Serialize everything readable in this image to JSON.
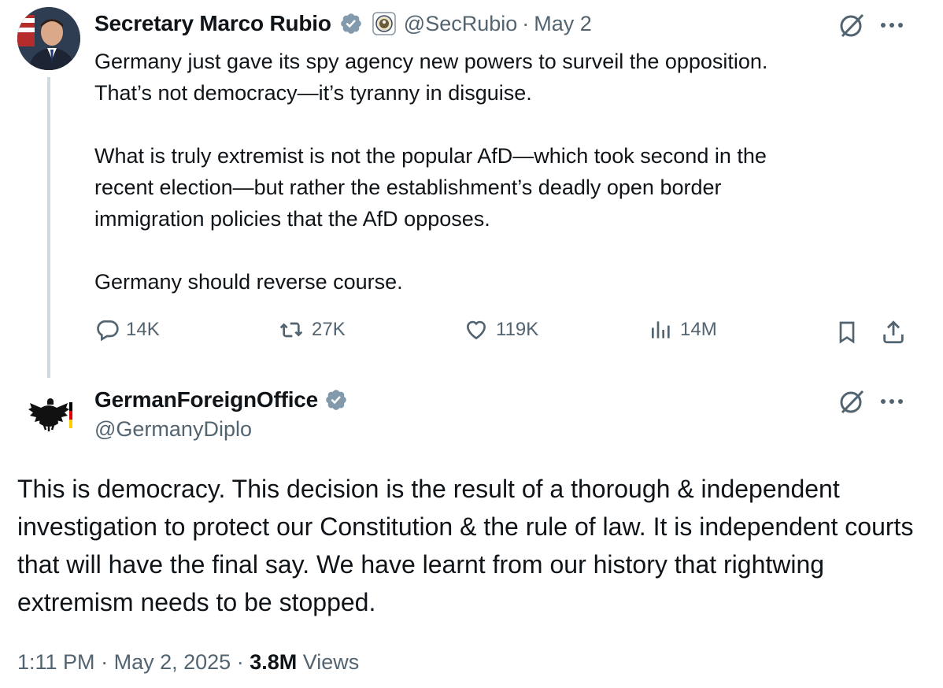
{
  "tweet1": {
    "name": "Secretary Marco Rubio",
    "handle": "@SecRubio",
    "dot": "·",
    "date": "May 2",
    "text": "Germany just gave its spy agency new powers to surveil the opposition.\nThat’s not democracy—it’s tyranny in disguise.\n\nWhat is truly extremist is not the popular AfD—which took second in the\nrecent election—but rather the establishment’s deadly open border\nimmigration policies that the AfD opposes.\n\nGermany should reverse course.",
    "replies": "14K",
    "reposts": "27K",
    "likes": "119K",
    "views": "14M",
    "verified_color": "#829aab"
  },
  "tweet2": {
    "name": "GermanForeignOffice",
    "handle": "@GermanyDiplo",
    "text": "This is democracy. This decision is the result of a thorough & independent investigation to protect our Constitution & the rule of law. It is independent courts that will have the final say. We have learnt from our history that rightwing extremism needs to be stopped.",
    "time": "1:11 PM",
    "sep": "·",
    "date": "May 2, 2025",
    "views_count": "3.8M",
    "views_label": "Views"
  },
  "icons": [
    "grok-icon",
    "more-icon",
    "reply-icon",
    "repost-icon",
    "like-icon",
    "views-icon",
    "bookmark-icon",
    "share-icon",
    "verified-icon",
    "state-seal-icon",
    "eagle-logo-icon"
  ],
  "colors": {
    "text": "#0f1419",
    "muted": "#536471",
    "thread_line": "#cfd9de"
  }
}
